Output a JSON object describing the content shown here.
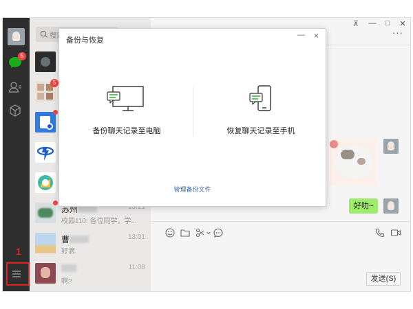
{
  "sidebar": {
    "chat_badge": "5",
    "step_marker": "1"
  },
  "search": {
    "placeholder": "搜索"
  },
  "chats": [
    {
      "name": "",
      "preview": "",
      "time": "",
      "badge": ""
    },
    {
      "name": "",
      "preview": "",
      "time": "",
      "badge": "5"
    },
    {
      "name": "",
      "preview": "",
      "time": ""
    },
    {
      "name": "",
      "preview": "",
      "time": ""
    },
    {
      "name": "",
      "preview": "",
      "time": ""
    },
    {
      "name": "苏州",
      "preview": "校园110: 各位同学，学...",
      "time": "13:21"
    },
    {
      "name": "曹",
      "preview": "好滴",
      "time": "13:01"
    },
    {
      "name": "",
      "preview": "啊?",
      "time": "11:08"
    }
  ],
  "window_controls": {
    "pin": "⊼",
    "minimize": "—",
    "maximize": "□",
    "close": "✕"
  },
  "conversation": {
    "more": "···",
    "bubble_text": "好叻~",
    "send_label": "发送(S)"
  },
  "dialog": {
    "title": "备份与恢复",
    "minimize": "—",
    "close": "×",
    "backup_to_pc": "备份聊天记录至电脑",
    "restore_to_phone": "恢复聊天记录至手机",
    "manage_backup": "管理备份文件"
  },
  "colors": {
    "rail_bg": "#2e2e2e",
    "list_bg": "#ebe9e8",
    "bubble_green": "#9eea6a",
    "chat_icon_green": "#1aad19",
    "badge_red": "#f54545",
    "highlight_red": "#e02020",
    "link_blue": "#3b6fb0"
  }
}
